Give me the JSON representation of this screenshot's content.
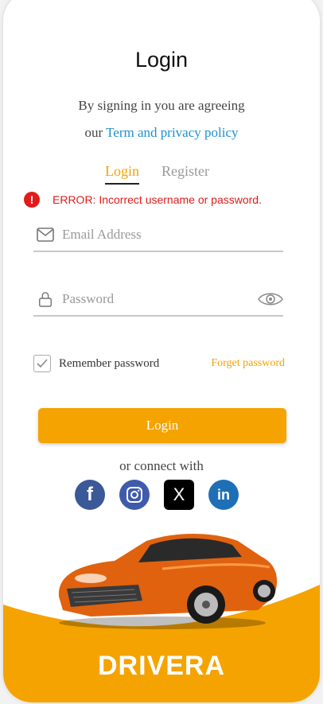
{
  "title": "Login",
  "subtitle": {
    "line1": "By signing in you are agreeing",
    "line2_prefix": "our",
    "line2_link": "Term and privacy policy"
  },
  "tabs": {
    "login": "Login",
    "register": "Register"
  },
  "error": {
    "icon_text": "!",
    "message": "ERROR: Incorrect username or password."
  },
  "email": {
    "placeholder": "Email Address",
    "icon": "mail-icon"
  },
  "password": {
    "placeholder": "Password",
    "icon": "lock-icon",
    "toggle_icon": "eye-icon"
  },
  "remember": {
    "label": "Remember password",
    "checked": true
  },
  "forget_label": "Forget password",
  "login_button": "Login",
  "connect_label": "or connect with",
  "socials": [
    {
      "name": "facebook",
      "glyph": "f"
    },
    {
      "name": "instagram",
      "glyph": ""
    },
    {
      "name": "x",
      "glyph": "X"
    },
    {
      "name": "linkedin",
      "glyph": "in"
    }
  ],
  "brand": "DRIVERA",
  "colors": {
    "accent": "#f5a300",
    "error": "#e01b1b",
    "link": "#1f8fcf"
  }
}
